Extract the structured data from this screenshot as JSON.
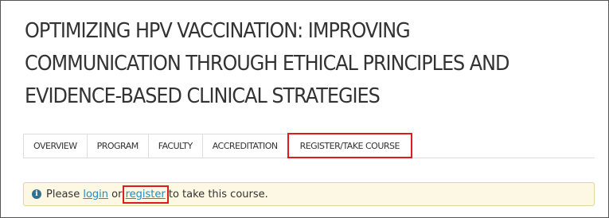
{
  "course": {
    "title": "OPTIMIZING HPV VACCINATION: IMPROVING COMMUNICATION THROUGH ETHICAL PRINCIPLES AND EVIDENCE-BASED CLINICAL STRATEGIES"
  },
  "tabs": [
    {
      "label": "OVERVIEW"
    },
    {
      "label": "PROGRAM"
    },
    {
      "label": "FACULTY"
    },
    {
      "label": "ACCREDITATION"
    },
    {
      "label": "REGISTER/TAKE COURSE",
      "active": true
    }
  ],
  "alert": {
    "icon": "info-icon",
    "prefix": "Please",
    "login_label": "login",
    "or_text": "or",
    "register_label": "register",
    "suffix": "to take this course."
  },
  "colors": {
    "highlight": "#e01b1b",
    "link": "#1a8ec6",
    "alert_bg": "#fcf8e3"
  }
}
